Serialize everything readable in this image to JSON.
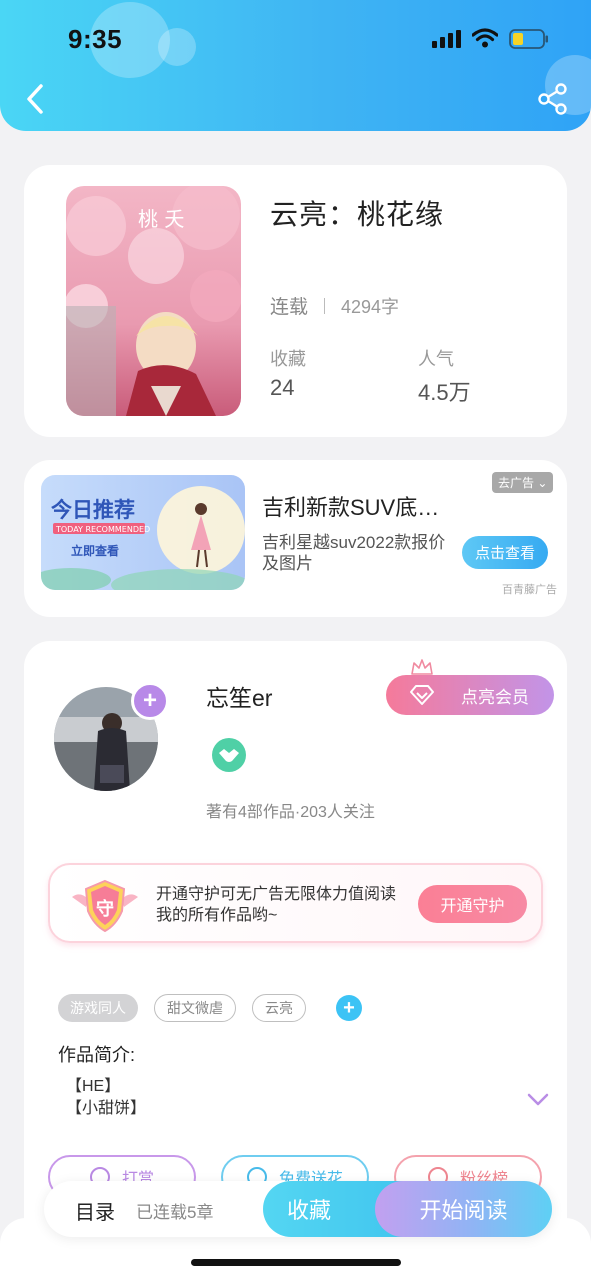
{
  "status_bar": {
    "time": "9:35"
  },
  "header": {
    "back_icon": "chevron-left-icon",
    "share_icon": "share-icon"
  },
  "book": {
    "title": "云亮：桃花缘",
    "status": "连载",
    "word_count": "4294字",
    "collect_label": "收藏",
    "collect_value": "24",
    "popularity_label": "人气",
    "popularity_value": "4.5万",
    "cover_text": "桃 夭"
  },
  "ad": {
    "banner_title": "今日推荐",
    "banner_subtitle": "TODAY RECOMMENDED",
    "banner_button": "立即查看",
    "title": "吉利新款SUV底…",
    "description": "吉利星越suv2022款报价及图片",
    "remove_tag": "去广告",
    "cta": "点击查看",
    "source": "百青藤广告"
  },
  "author": {
    "name": "忘笙er",
    "vip_button": "点亮会员",
    "meta": "著有4部作品·203人关注",
    "guard_badge": "守",
    "guard_text": "开通守护可无广告无限体力值阅读我的所有作品哟~",
    "guard_button": "开通守护",
    "tags": [
      "游戏同人",
      "甜文微虐",
      "云亮"
    ],
    "intro_label": "作品简介:",
    "intro_line1": "【HE】",
    "intro_line2": "【小甜饼】",
    "actions": [
      "打赏",
      "免费送花",
      "粉丝榜"
    ]
  },
  "bottom": {
    "toc": "目录",
    "chapters": "已连载5章",
    "collect": "收藏",
    "read": "开始阅读"
  },
  "colors": {
    "header": "#3fb4f3",
    "accent_blue": "#3cc3f5",
    "vip_pink": "#f57a9a",
    "vip_purple": "#c294e8"
  }
}
